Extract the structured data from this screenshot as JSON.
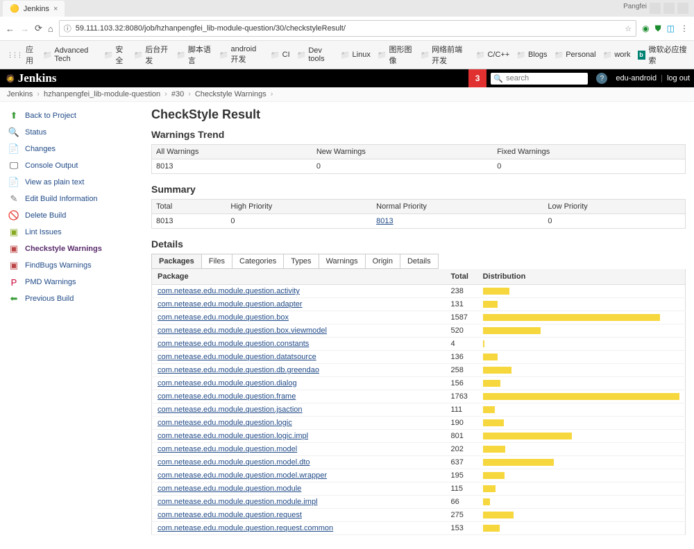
{
  "browser": {
    "tab_title": "Jenkins",
    "titlebar_user": "Pangfei",
    "url": "59.111.103.32:8080/job/hzhanpengfei_lib-module-question/30/checkstyleResult/",
    "bookmarks": [
      "应用",
      "Advanced Tech",
      "安全",
      "后台开发",
      "脚本语言",
      "android开发",
      "CI",
      "Dev tools",
      "Linux",
      "图形图像",
      "网络前端开发",
      "C/C++",
      "Blogs",
      "Personal",
      "work",
      "微软必应搜索"
    ]
  },
  "header": {
    "brand": "Jenkins",
    "notif_count": "3",
    "search_placeholder": "search",
    "user": "edu-android",
    "logout": "log out"
  },
  "breadcrumb": [
    "Jenkins",
    "hzhanpengfei_lib-module-question",
    "#30",
    "Checkstyle Warnings"
  ],
  "sidebar": [
    {
      "icon": "⬆",
      "color": "#3a9b3a",
      "label": "Back to Project",
      "current": false
    },
    {
      "icon": "🔍",
      "color": "#888",
      "label": "Status",
      "current": false
    },
    {
      "icon": "📄",
      "color": "#888",
      "label": "Changes",
      "current": false
    },
    {
      "icon": "🖵",
      "color": "#222",
      "label": "Console Output",
      "current": false
    },
    {
      "icon": "📄",
      "color": "#bbb",
      "label": "View as plain text",
      "current": false
    },
    {
      "icon": "✎",
      "color": "#777",
      "label": "Edit Build Information",
      "current": false
    },
    {
      "icon": "🚫",
      "color": "#c33",
      "label": "Delete Build",
      "current": false
    },
    {
      "icon": "▣",
      "color": "#8a2",
      "label": "Lint Issues",
      "current": false
    },
    {
      "icon": "▣",
      "color": "#b44",
      "label": "Checkstyle Warnings",
      "current": true
    },
    {
      "icon": "▣",
      "color": "#b44",
      "label": "FindBugs Warnings",
      "current": false
    },
    {
      "icon": "P",
      "color": "#c03",
      "label": "PMD Warnings",
      "current": false
    },
    {
      "icon": "⬅",
      "color": "#3a9b3a",
      "label": "Previous Build",
      "current": false
    }
  ],
  "page": {
    "title": "CheckStyle Result",
    "trend_title": "Warnings Trend",
    "trend_headers": [
      "All Warnings",
      "New Warnings",
      "Fixed Warnings"
    ],
    "trend_row": [
      "8013",
      "0",
      "0"
    ],
    "summary_title": "Summary",
    "summary_headers": [
      "Total",
      "High Priority",
      "Normal Priority",
      "Low Priority"
    ],
    "summary_row": [
      "8013",
      "0",
      "8013",
      "0"
    ],
    "summary_link_col": 2,
    "details_title": "Details",
    "tabs": [
      "Packages",
      "Files",
      "Categories",
      "Types",
      "Warnings",
      "Origin",
      "Details"
    ],
    "active_tab": 0,
    "details_headers": [
      "Package",
      "Total",
      "Distribution"
    ],
    "packages": [
      {
        "name": "com.netease.edu.module.question.activity",
        "total": 238
      },
      {
        "name": "com.netease.edu.module.question.adapter",
        "total": 131
      },
      {
        "name": "com.netease.edu.module.question.box",
        "total": 1587
      },
      {
        "name": "com.netease.edu.module.question.box.viewmodel",
        "total": 520
      },
      {
        "name": "com.netease.edu.module.question.constants",
        "total": 4
      },
      {
        "name": "com.netease.edu.module.question.datatsource",
        "total": 136
      },
      {
        "name": "com.netease.edu.module.question.db.greendao",
        "total": 258
      },
      {
        "name": "com.netease.edu.module.question.dialog",
        "total": 156
      },
      {
        "name": "com.netease.edu.module.question.frame",
        "total": 1763
      },
      {
        "name": "com.netease.edu.module.question.jsaction",
        "total": 111
      },
      {
        "name": "com.netease.edu.module.question.logic",
        "total": 190
      },
      {
        "name": "com.netease.edu.module.question.logic.impl",
        "total": 801
      },
      {
        "name": "com.netease.edu.module.question.model",
        "total": 202
      },
      {
        "name": "com.netease.edu.module.question.model.dto",
        "total": 637
      },
      {
        "name": "com.netease.edu.module.question.model.wrapper",
        "total": 195
      },
      {
        "name": "com.netease.edu.module.question.module",
        "total": 115
      },
      {
        "name": "com.netease.edu.module.question.module.impl",
        "total": 66
      },
      {
        "name": "com.netease.edu.module.question.request",
        "total": 275
      },
      {
        "name": "com.netease.edu.module.question.request.common",
        "total": 153
      }
    ]
  }
}
